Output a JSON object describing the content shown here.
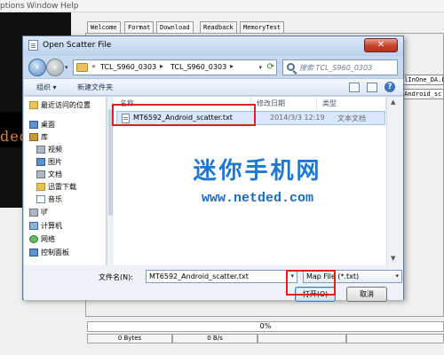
{
  "app": {
    "menu": [
      "ptions",
      "Window",
      "Help"
    ],
    "tabs": [
      "Welcome",
      "Format",
      "Download",
      "Readback",
      "MemoryTest"
    ],
    "active_tab": "Download",
    "banner_text": "ded",
    "right_fields": [
      "llInOne_DA.bin",
      "_Android_sc"
    ],
    "progress_text": "0%",
    "stats": [
      "0 Bytes",
      "0 B/s",
      "",
      ""
    ]
  },
  "dialog": {
    "title": "Open Scatter File",
    "close_symbol": "✕",
    "address": {
      "prefix": "«",
      "crumbs": [
        "TCL_S960_0303",
        "TCL_S960_0303"
      ],
      "separator": "▸"
    },
    "search": {
      "placeholder": "搜索 TCL_S960_0303"
    },
    "toolbar": {
      "organize": "组织 ▾",
      "new_folder": "新建文件夹",
      "help": "?"
    },
    "nav": {
      "recent": "最近访问的位置",
      "desktop": "桌面",
      "library": "库",
      "video": "视频",
      "pictures": "图片",
      "documents": "文档",
      "thunder": "迅雷下载",
      "music": "音乐",
      "user": "ljf",
      "computer": "计算机",
      "network": "网络",
      "control_panel": "控制面板"
    },
    "columns": {
      "name": "名称",
      "modified": "修改日期",
      "type": "类型"
    },
    "files": [
      {
        "name": "MT6592_Android_scatter.txt",
        "modified": "2014/3/3 12:19",
        "type": "文本文档"
      }
    ],
    "footer": {
      "filename_label": "文件名(N):",
      "filename_value": "MT6592_Android_scatter.txt",
      "filetype_value": "Map File (*.txt)",
      "open_button": "打开(O)",
      "cancel_button": "取消"
    }
  },
  "watermark": {
    "text": "迷你手机网",
    "url": "www.netded.com"
  }
}
